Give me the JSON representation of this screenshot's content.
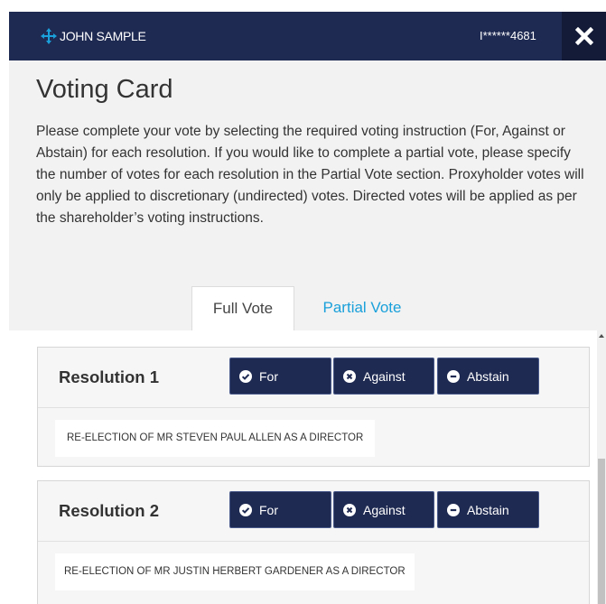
{
  "header": {
    "user_name": "JOHN SAMPLE",
    "account_masked": "I******4681",
    "brand_color": "#1f2a52"
  },
  "card": {
    "title": "Voting Card",
    "intro": "Please complete your vote by selecting the required voting instruction (For, Against or Abstain) for each resolution. If you would like to complete a partial vote, please specify the number of votes for each resolution in the Partial Vote section. Proxyholder votes will only be applied to discretionary (undirected) votes. Directed votes will be applied as per the shareholder’s voting instructions."
  },
  "tabs": [
    {
      "label": "Full Vote",
      "active": true
    },
    {
      "label": "Partial Vote",
      "active": false
    }
  ],
  "vote_options": {
    "for": "For",
    "against": "Against",
    "abstain": "Abstain"
  },
  "resolutions": [
    {
      "title": "Resolution 1",
      "description": "RE-ELECTION OF MR STEVEN PAUL ALLEN AS A DIRECTOR"
    },
    {
      "title": "Resolution 2",
      "description": "RE-ELECTION OF MR JUSTIN HERBERT GARDENER AS A DIRECTOR"
    }
  ],
  "colors": {
    "accent": "#1aa0da",
    "button": "#1f2a52"
  }
}
